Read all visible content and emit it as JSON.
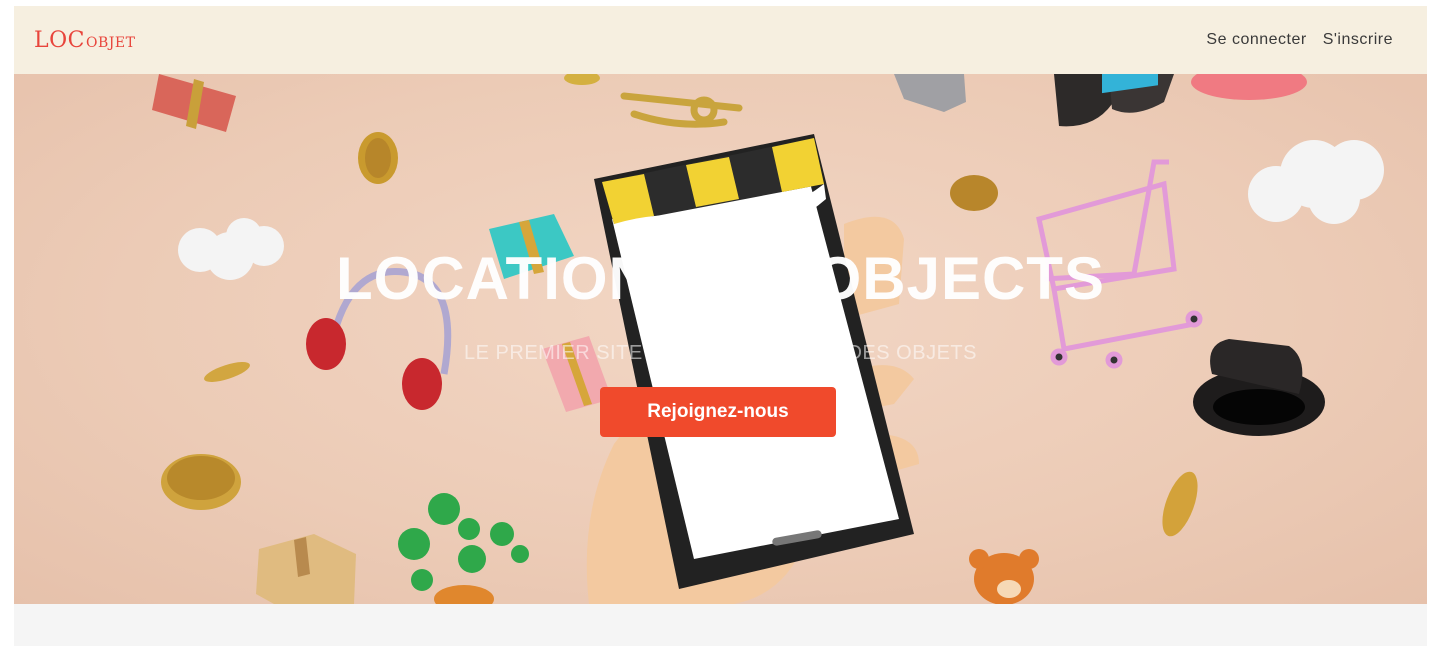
{
  "navbar": {
    "brand_main": "LOC",
    "brand_small": "OBJET",
    "links": [
      {
        "label": "Se connecter"
      },
      {
        "label": "S'inscrire"
      }
    ]
  },
  "hero": {
    "title": "LOCATION DES OBJECTS",
    "subtitle": "LE PREMIER SITE WEB DE LOCATION DES OBJETS",
    "cta_label": "Rejoignez-nous"
  },
  "colors": {
    "brand": "#e8453c",
    "cta": "#f04a2c",
    "navbar_bg": "#f6efe0",
    "hero_bg": "#eccbb6"
  }
}
